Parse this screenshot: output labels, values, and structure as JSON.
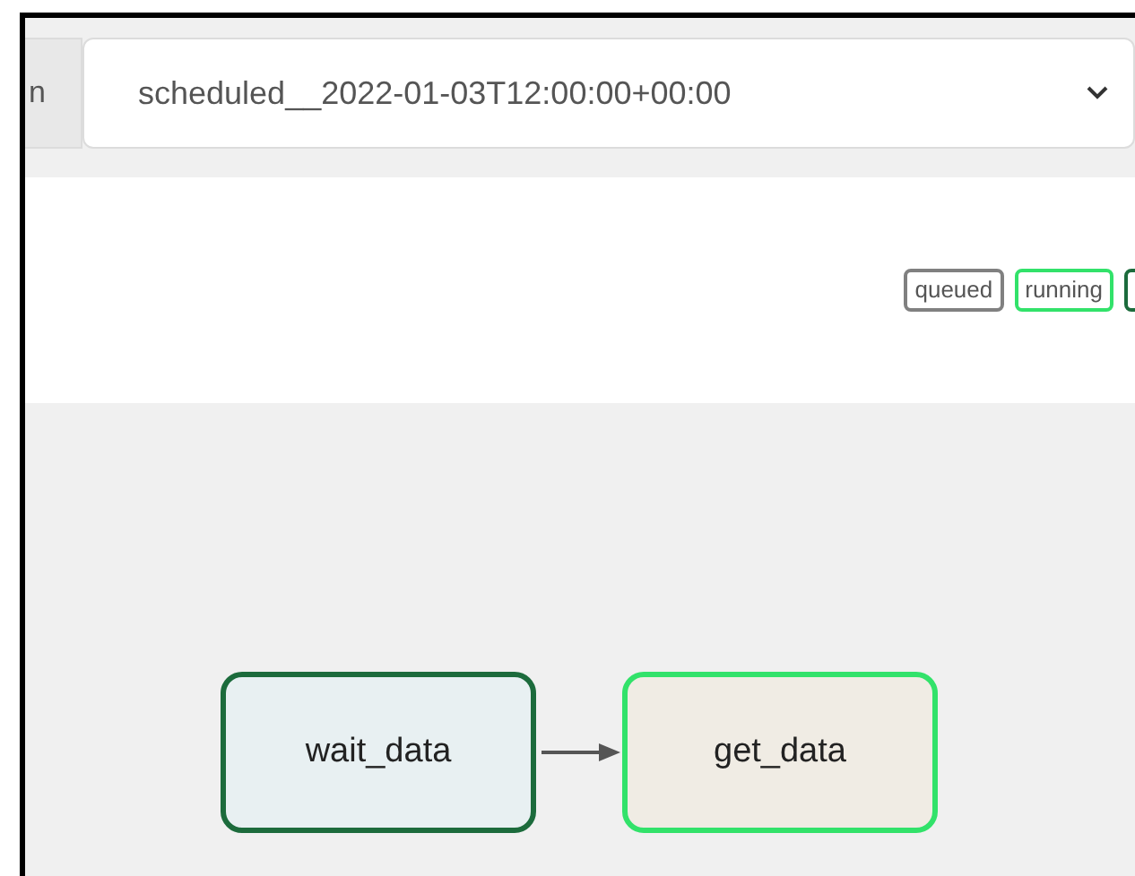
{
  "run_picker": {
    "prefix": "n",
    "value": "scheduled__2022-01-03T12:00:00+00:00"
  },
  "legend": [
    {
      "label": "queued",
      "color": "#808080"
    },
    {
      "label": "running",
      "color": "#32e26a"
    },
    {
      "color": "#1c6b3c"
    }
  ],
  "graph": {
    "nodes": [
      {
        "label": "wait_data",
        "color": "#1c6b3c"
      },
      {
        "label": "get_data",
        "color": "#32e26a"
      }
    ]
  }
}
